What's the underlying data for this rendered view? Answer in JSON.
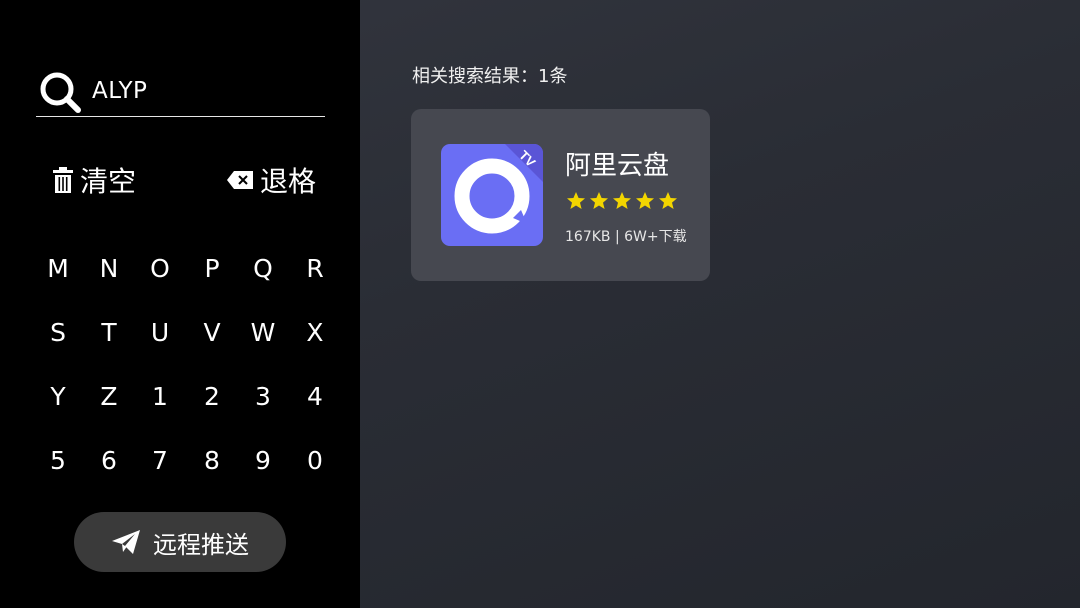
{
  "search": {
    "query": "ALYP"
  },
  "actions": {
    "clear_label": "清空",
    "backspace_label": "退格"
  },
  "keyboard": {
    "rows": [
      [
        "M",
        "N",
        "O",
        "P",
        "Q",
        "R"
      ],
      [
        "S",
        "T",
        "U",
        "V",
        "W",
        "X"
      ],
      [
        "Y",
        "Z",
        "1",
        "2",
        "3",
        "4"
      ],
      [
        "5",
        "6",
        "7",
        "8",
        "9",
        "0"
      ]
    ]
  },
  "push_button": {
    "label": "远程推送"
  },
  "results": {
    "header": "相关搜索结果：1条",
    "items": [
      {
        "name": "阿里云盘",
        "rating": 5,
        "meta": "167KB | 6W+下载",
        "icon_badge": "TV"
      }
    ]
  },
  "colors": {
    "left_panel_bg": "#000000",
    "app_icon_bg": "#6a6ef4",
    "star": "#f2d500",
    "card_bg": "#464850"
  },
  "icons": {
    "search": "search-icon",
    "clear": "trash-icon",
    "backspace": "backspace-icon",
    "push": "paper-plane-icon"
  }
}
